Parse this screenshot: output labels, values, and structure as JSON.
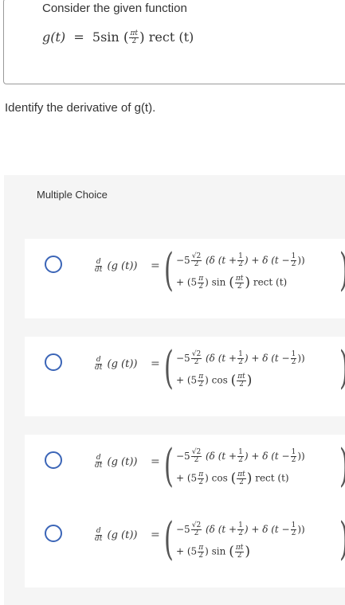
{
  "prompt": {
    "text": "Consider the given function",
    "function_lhs": "g(t)",
    "equals": "=",
    "function_rhs_start": "5sin",
    "pi_t": "πt",
    "two": "2",
    "rect": "rect (t)"
  },
  "question": "Identify the derivative of g(t).",
  "mc": {
    "heading": "Multiple Choice",
    "common": {
      "lhs_d": "d",
      "lhs_dt": "dt",
      "lhs_rest": "(g (t))",
      "eq": "=",
      "line1_a": "−5",
      "sqrt2": "√2",
      "two": "2",
      "line1_b": "(δ (t +",
      "one": "1",
      "line1_c": ") + δ (t −",
      "line1_d": "))",
      "plus": "+ (5",
      "pi": "π",
      "close": ")",
      "pit": "πt"
    },
    "choices": [
      {
        "trig": "sin",
        "tail": "rect (t)"
      },
      {
        "trig": "cos",
        "tail": ""
      },
      {
        "trig": "cos",
        "tail": "rect (t)"
      },
      {
        "trig": "sin",
        "tail": ""
      }
    ]
  }
}
